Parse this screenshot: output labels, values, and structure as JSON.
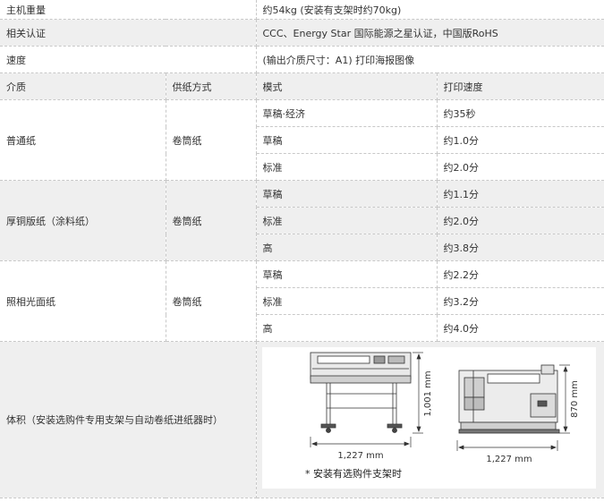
{
  "spec": {
    "weight": {
      "label": "主机重量",
      "value": "约54kg (安装有支架时约70kg)"
    },
    "certification": {
      "label": "相关认证",
      "value": "CCC、Energy Star 国际能源之星认证，中国版RoHS"
    },
    "speed": {
      "label": "速度",
      "note": "(输出介质尺寸：A1) 打印海报图像"
    },
    "headers": {
      "media": "介质",
      "feed": "供纸方式",
      "mode": "模式",
      "print_speed": "打印速度"
    },
    "groups": [
      {
        "media": "普通纸",
        "feed": "卷筒纸",
        "rows": [
          {
            "mode": "草稿·经济",
            "speed": "约35秒"
          },
          {
            "mode": "草稿",
            "speed": "约1.0分"
          },
          {
            "mode": "标准",
            "speed": "约2.0分"
          }
        ]
      },
      {
        "media": "厚铜版纸（涂料纸）",
        "feed": "卷筒纸",
        "rows": [
          {
            "mode": "草稿",
            "speed": "约1.1分"
          },
          {
            "mode": "标准",
            "speed": "约2.0分"
          },
          {
            "mode": "高",
            "speed": "约3.8分"
          }
        ]
      },
      {
        "media": "照相光面纸",
        "feed": "卷筒纸",
        "rows": [
          {
            "mode": "草稿",
            "speed": "约2.2分"
          },
          {
            "mode": "标准",
            "speed": "约3.2分"
          },
          {
            "mode": "高",
            "speed": "约4.0分"
          }
        ]
      }
    ],
    "dimensions": {
      "label": "体积（安装选购件专用支架与自动卷纸进纸器时）",
      "front_width": "1,227 mm",
      "front_height": "1,001 mm",
      "side_width": "1,227 mm",
      "side_height": "870 mm",
      "note": "* 安装有选购件支架时"
    }
  }
}
